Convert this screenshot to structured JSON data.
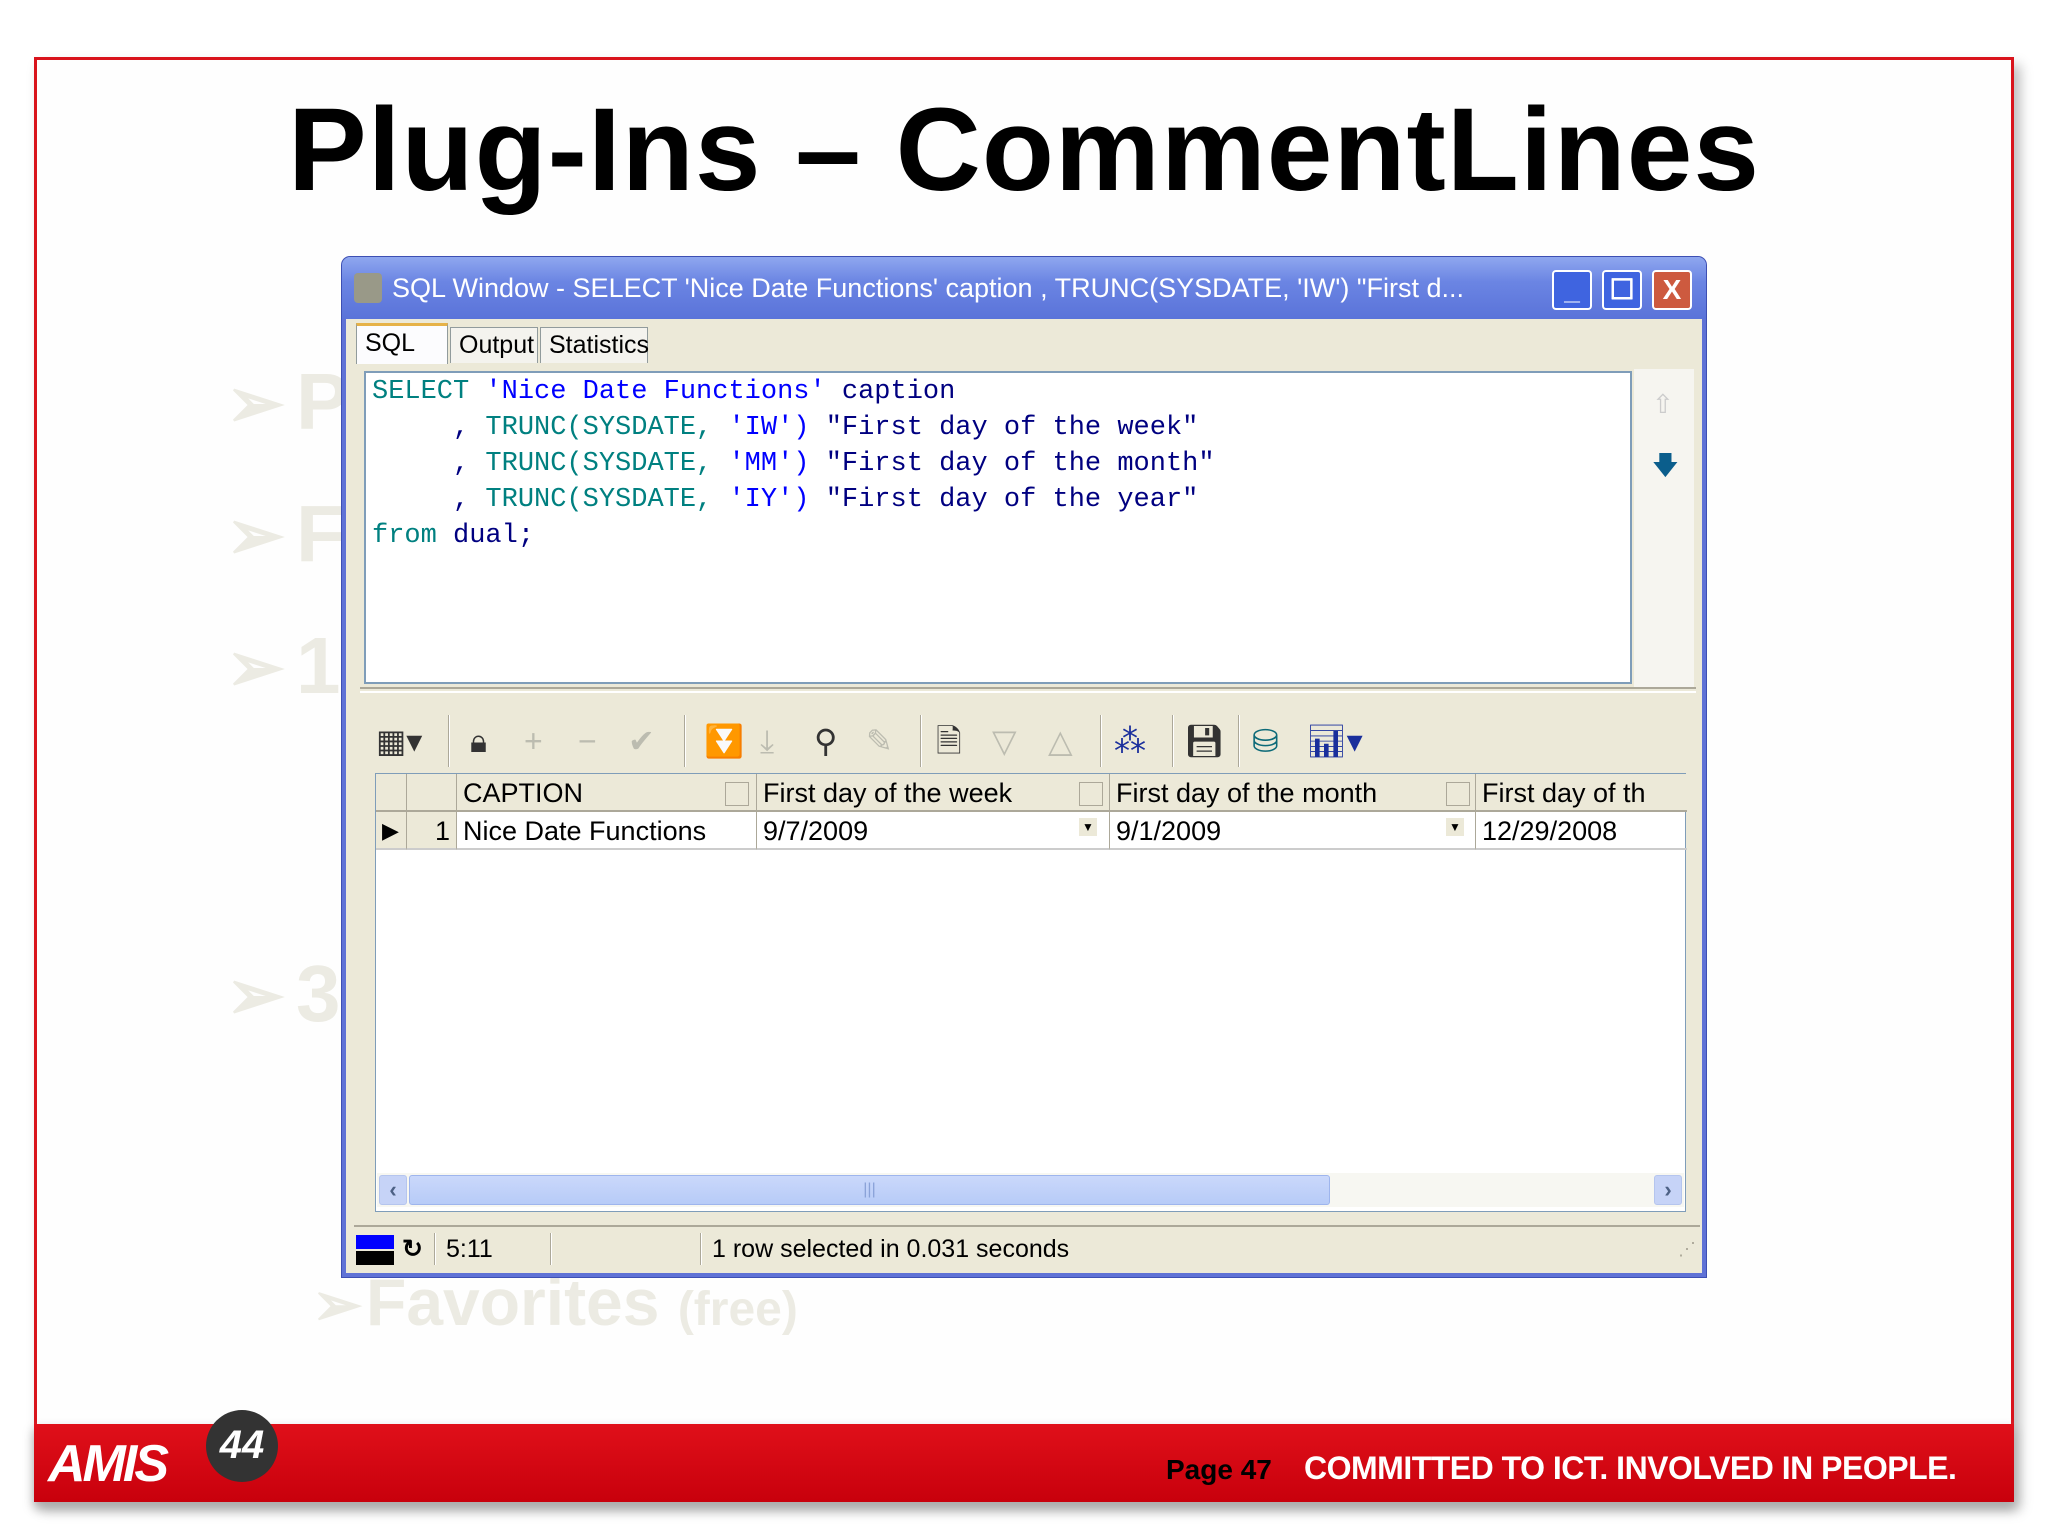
{
  "slide": {
    "title": "Plug-Ins – CommentLines",
    "background_bullets": [
      "P",
      "F",
      "1",
      "3"
    ],
    "favorites": "Favorites",
    "favorites_note": "(free)",
    "footer": {
      "logo": "AMIS",
      "page": "Page 47",
      "slogan": "COMMITTED TO ICT.  INVOLVED IN PEOPLE."
    },
    "colors": {
      "frame": "#d9141c",
      "footer": "#d0000c",
      "titlebar": "#5a73d9"
    }
  },
  "window": {
    "title": "SQL Window - SELECT 'Nice Date Functions' caption , TRUNC(SYSDATE, 'IW') \"First d...",
    "controls": {
      "minimize": "_",
      "maximize": "☐",
      "close": "X"
    },
    "tabs": [
      {
        "label": "SQL",
        "active": true
      },
      {
        "label": "Output"
      },
      {
        "label": "Statistics"
      }
    ],
    "sql": {
      "line1": {
        "kw": "SELECT",
        "str": "'Nice Date Functions'",
        "rest": "caption"
      },
      "line2": {
        "lead": "     ,",
        "fn": "TRUNC(SYSDATE,",
        "arg": "'IW')",
        "alias": "\"First day of the week\""
      },
      "line3": {
        "lead": "     ,",
        "fn": "TRUNC(SYSDATE,",
        "arg": "'MM')",
        "alias": "\"First day of the month\""
      },
      "line4": {
        "lead": "     ,",
        "fn": "TRUNC(SYSDATE,",
        "arg": "'IY')",
        "alias": "\"First day of the year\""
      },
      "line5": {
        "kw": "from",
        "rest": "dual;"
      }
    },
    "grid": {
      "columns": [
        "CAPTION",
        "First day of the week",
        "First day of the month",
        "First day of th"
      ],
      "rows": [
        {
          "num": "1",
          "cells": [
            "Nice Date Functions",
            "9/7/2009",
            "9/1/2009",
            "12/29/2008"
          ]
        }
      ]
    },
    "status": {
      "time": "5:11",
      "message": "1 row selected in 0.031 seconds"
    }
  }
}
